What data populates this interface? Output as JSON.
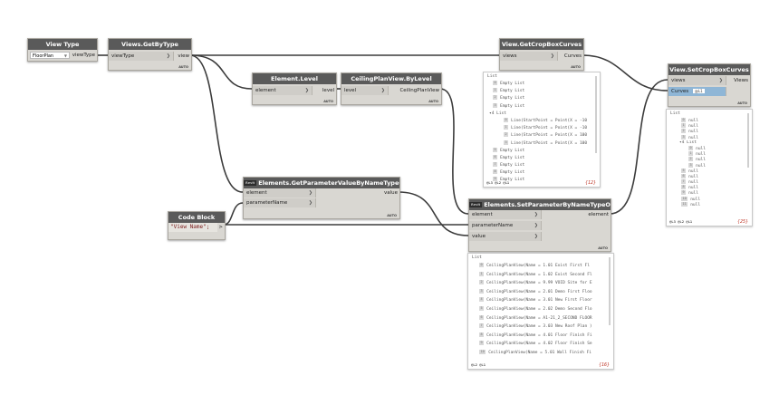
{
  "nodes": {
    "view_type": {
      "title": "View Type",
      "selected": "FloorPlan",
      "out": "viewType"
    },
    "views_getbytype": {
      "title": "Views.GetByType",
      "in": "viewType",
      "out": "view",
      "lacing": "AUTO"
    },
    "element_level": {
      "title": "Element.Level",
      "in": "element",
      "out": "level",
      "lacing": "AUTO"
    },
    "ceiling_plan": {
      "title": "CeilingPlanView.ByLevel",
      "in": "level",
      "out": "CeilingPlanView",
      "lacing": "AUTO"
    },
    "get_crop": {
      "title": "View.GetCropBoxCurves",
      "in": "views",
      "out": "Curves",
      "lacing": "AUTO"
    },
    "get_param": {
      "badge": "Revit",
      "title": "Elements.GetParameterValueByNameTypeOrInstance",
      "in1": "element",
      "in2": "parameterName",
      "out": "value",
      "lacing": "AUTO"
    },
    "code_block": {
      "title": "Code Block",
      "code": "\"View Name\";",
      "out": ">"
    },
    "set_param": {
      "badge": "Revit",
      "title": "Elements.SetParameterByNameTypeOrInstance",
      "in1": "element",
      "in2": "parameterName",
      "in3": "value",
      "out": "element",
      "lacing": "AUTO"
    },
    "set_crop": {
      "title": "View.SetCropBoxCurves",
      "in1": "views",
      "in2": "Curves",
      "out": "Views",
      "lacing": "AUTO",
      "curves_tag": "@L1"
    }
  },
  "previews": {
    "crop_curves": {
      "title": "List",
      "lines": [
        {
          "idx": "0",
          "text": "Empty List"
        },
        {
          "idx": "1",
          "text": "Empty List"
        },
        {
          "idx": "2",
          "text": "Empty List"
        },
        {
          "idx": "3",
          "text": "Empty List"
        },
        {
          "idx": "",
          "text": "▾4 List"
        },
        {
          "idx": "0",
          "text": "Line(StartPoint = Point(X = -10"
        },
        {
          "idx": "1",
          "text": "Line(StartPoint = Point(X = -10"
        },
        {
          "idx": "2",
          "text": "Line(StartPoint = Point(X = 100"
        },
        {
          "idx": "3",
          "text": "Line(StartPoint = Point(X = 100"
        },
        {
          "idx": "5",
          "text": "Empty List"
        },
        {
          "idx": "6",
          "text": "Empty List"
        },
        {
          "idx": "7",
          "text": "Empty List"
        },
        {
          "idx": "8",
          "text": "Empty List"
        },
        {
          "idx": "9",
          "text": "Empty List"
        }
      ],
      "levels": "@L3 @L2 @L1",
      "count": "{12}"
    },
    "set_crop": {
      "title": "List",
      "lines": [
        {
          "idx": "0",
          "text": "null"
        },
        {
          "idx": "1",
          "text": "null"
        },
        {
          "idx": "2",
          "text": "null"
        },
        {
          "idx": "3",
          "text": "null"
        },
        {
          "idx": "",
          "text": "▾4 List"
        },
        {
          "idx": "0",
          "text": "null"
        },
        {
          "idx": "1",
          "text": "null"
        },
        {
          "idx": "2",
          "text": "null"
        },
        {
          "idx": "3",
          "text": "null"
        },
        {
          "idx": "5",
          "text": "null"
        },
        {
          "idx": "6",
          "text": "null"
        },
        {
          "idx": "7",
          "text": "null"
        },
        {
          "idx": "8",
          "text": "null"
        },
        {
          "idx": "9",
          "text": "null"
        },
        {
          "idx": "10",
          "text": "null"
        },
        {
          "idx": "11",
          "text": "null"
        }
      ],
      "levels": "@L3 @L2 @L1",
      "count": "{25}"
    },
    "set_param": {
      "title": "List",
      "lines": [
        {
          "idx": "0",
          "text": "CeilingPlanView(Name = 1.01 Exist First Fl"
        },
        {
          "idx": "1",
          "text": "CeilingPlanView(Name = 1.02 Exist Second Fl"
        },
        {
          "idx": "2",
          "text": "CeilingPlanView(Name = 9.99 VOID Site for E"
        },
        {
          "idx": "3",
          "text": "CeilingPlanView(Name = 2.01 Demo First Floo"
        },
        {
          "idx": "4",
          "text": "CeilingPlanView(Name = 3.01 New First Floor"
        },
        {
          "idx": "5",
          "text": "CeilingPlanView(Name = 2.02 Demo Second Flo"
        },
        {
          "idx": "6",
          "text": "CeilingPlanView(Name = A1-21_2_SECOND FLOOR"
        },
        {
          "idx": "7",
          "text": "CeilingPlanView(Name = 3.03 New Roof Plan )"
        },
        {
          "idx": "8",
          "text": "CeilingPlanView(Name = 4.01 Floor Finish Fi"
        },
        {
          "idx": "9",
          "text": "CeilingPlanView(Name = 4.02 Floor Finish Se"
        },
        {
          "idx": "10",
          "text": "CeilingPlanView(Name = 5.01 Wall Finish Fi"
        }
      ],
      "levels": "@L2 @L1",
      "count": "{16}"
    }
  },
  "colors": {
    "wire": "#3c3c3c",
    "node_header": "#5a5a5a",
    "node_body": "#d9d7d2",
    "count": "#c0392b"
  }
}
